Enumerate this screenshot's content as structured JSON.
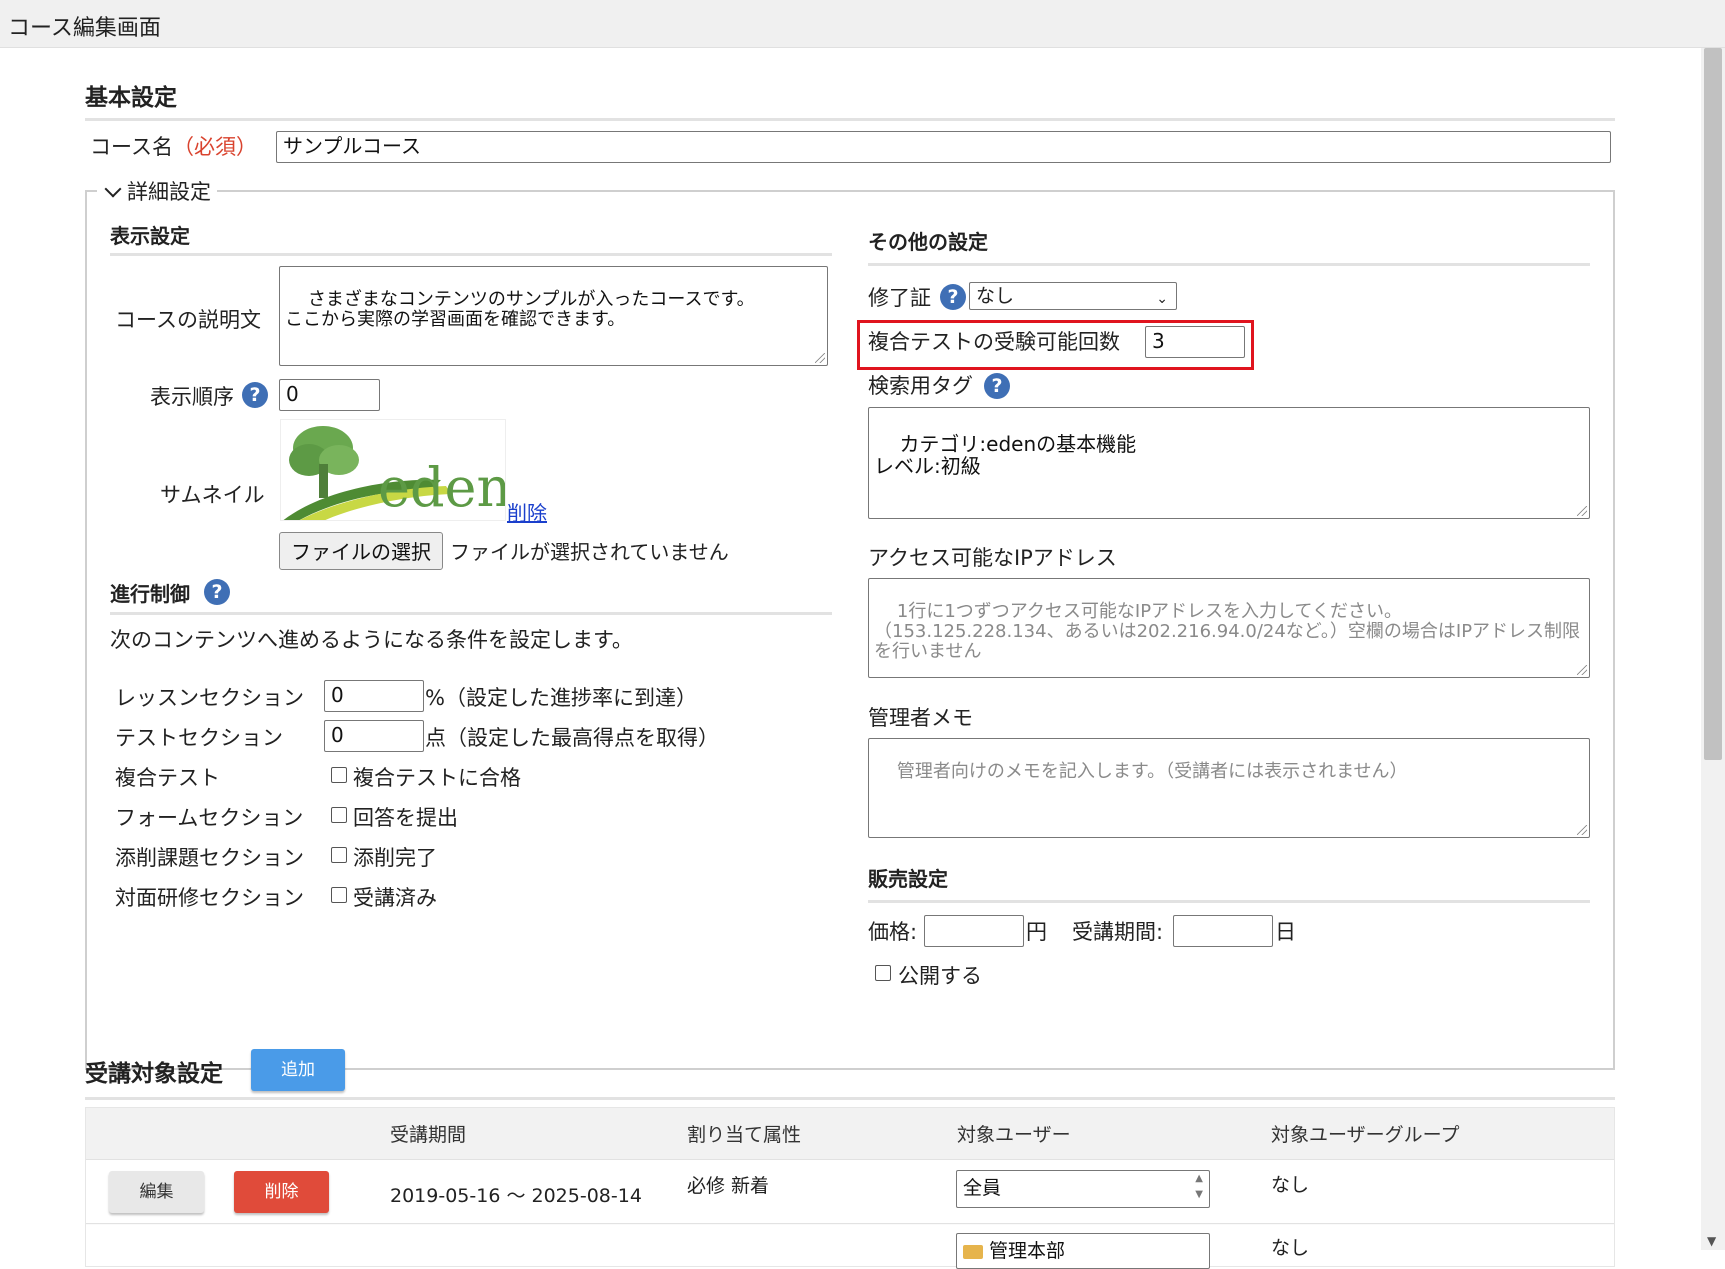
{
  "window": {
    "title": "コース編集画面"
  },
  "basic": {
    "heading": "基本設定",
    "course_name_label": "コース名",
    "required_label": "（必須）",
    "course_name_value": "サンプルコース"
  },
  "details": {
    "legend": "詳細設定",
    "display": {
      "heading": "表示設定",
      "description_label": "コースの説明文",
      "description_value": "さまざまなコンテンツのサンプルが入ったコースです。\nここから実際の学習画面を確認できます。",
      "order_label": "表示順序",
      "order_value": "0",
      "thumbnail_label": "サムネイル",
      "thumbnail_logo_text": "eden",
      "delete_link": "削除",
      "file_button": "ファイルの選択",
      "file_status": "ファイルが選択されていません"
    },
    "progress": {
      "heading": "進行制御",
      "description": "次のコンテンツへ進めるようになる条件を設定します。",
      "lesson_label": "レッスンセクション",
      "lesson_value": "0",
      "lesson_suffix": "%（設定した進捗率に到達）",
      "test_label": "テストセクション",
      "test_value": "0",
      "test_suffix": "点（設定した最高得点を取得）",
      "compound_label": "複合テスト",
      "compound_check": "複合テストに合格",
      "form_label": "フォームセクション",
      "form_check": "回答を提出",
      "assignment_label": "添削課題セクション",
      "assignment_check": "添削完了",
      "training_label": "対面研修セクション",
      "training_check": "受講済み"
    },
    "other": {
      "heading": "その他の設定",
      "certificate_label": "修了証",
      "certificate_value": "なし",
      "attempts_label": "複合テストの受験可能回数",
      "attempts_value": "3",
      "tags_label": "検索用タグ",
      "tags_value": "カテゴリ:edenの基本機能\nレベル:初級",
      "ip_label": "アクセス可能なIPアドレス",
      "ip_placeholder": "1行に1つずつアクセス可能なIPアドレスを入力してください。\n（153.125.228.134、あるいは202.216.94.0/24など。）空欄の場合はIPアドレス制限を行いません",
      "memo_label": "管理者メモ",
      "memo_placeholder": "管理者向けのメモを記入します。（受講者には表示されません）"
    },
    "sales": {
      "heading": "販売設定",
      "price_label": "価格:",
      "price_unit": "円",
      "period_label": "受講期間:",
      "period_unit": "日",
      "publish_label": "公開する"
    }
  },
  "targets": {
    "heading": "受講対象設定",
    "add_button": "追加",
    "columns": [
      "受講期間",
      "割り当て属性",
      "対象ユーザー",
      "対象ユーザーグループ"
    ],
    "rows": [
      {
        "edit": "編集",
        "delete": "削除",
        "period": "2019-05-16 〜 2025-08-14",
        "attributes": "必修 新着",
        "users": "全員",
        "groups": "なし"
      },
      {
        "users": "管理本部",
        "groups": "なし"
      }
    ]
  },
  "colors": {
    "highlight": "#e0141e",
    "help": "#3f6fb5",
    "delete": "#e04b3a",
    "add": "#4a9be8"
  }
}
